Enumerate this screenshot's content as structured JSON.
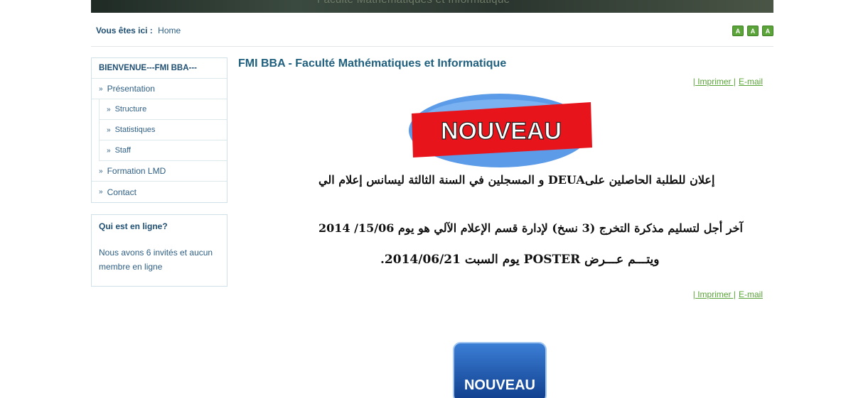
{
  "banner": {
    "text": "Faculté Mathématiques et Informatique"
  },
  "breadcrumb": {
    "label": "Vous êtes ici :",
    "home": "Home"
  },
  "font_controls": [
    "A",
    "A",
    "A"
  ],
  "menu": {
    "header": "BIENVENUE---FMI BBA---",
    "items": [
      {
        "label": "Présentation"
      },
      {
        "label": "Structure"
      },
      {
        "label": "Statistiques"
      },
      {
        "label": "Staff"
      },
      {
        "label": "Formation LMD"
      },
      {
        "label": "Contact"
      }
    ]
  },
  "online": {
    "title": "Qui est en ligne?",
    "text": "Nous avons 6 invités et aucun membre en ligne"
  },
  "article": {
    "title": "FMI BBA - Faculté Mathématiques et Informatique",
    "print_label": "| Imprimer |",
    "email_label": "E-mail",
    "badge_text": "NOUVEAU",
    "line1": "إعلان للطلبة الحاصلين علىDEUA و المسجلين في السنة الثالثة ليسانس إعلام الي",
    "line2": "آخر أجل لتسليم مذكرة التخرج (3 نسخ) لإدارة قسم الإعلام الآلي هو يوم 15/06/ 2014",
    "line3": "ويتـــم عـــرض   POSTER يوم السبت  2014/06/21.",
    "badge2_text": "NOUVEAU"
  },
  "colors": {
    "accent": "#1f5f7e",
    "link_green": "#5aa43a",
    "badge_red": "#e8141c",
    "badge_blue": "#3c7fd6"
  }
}
